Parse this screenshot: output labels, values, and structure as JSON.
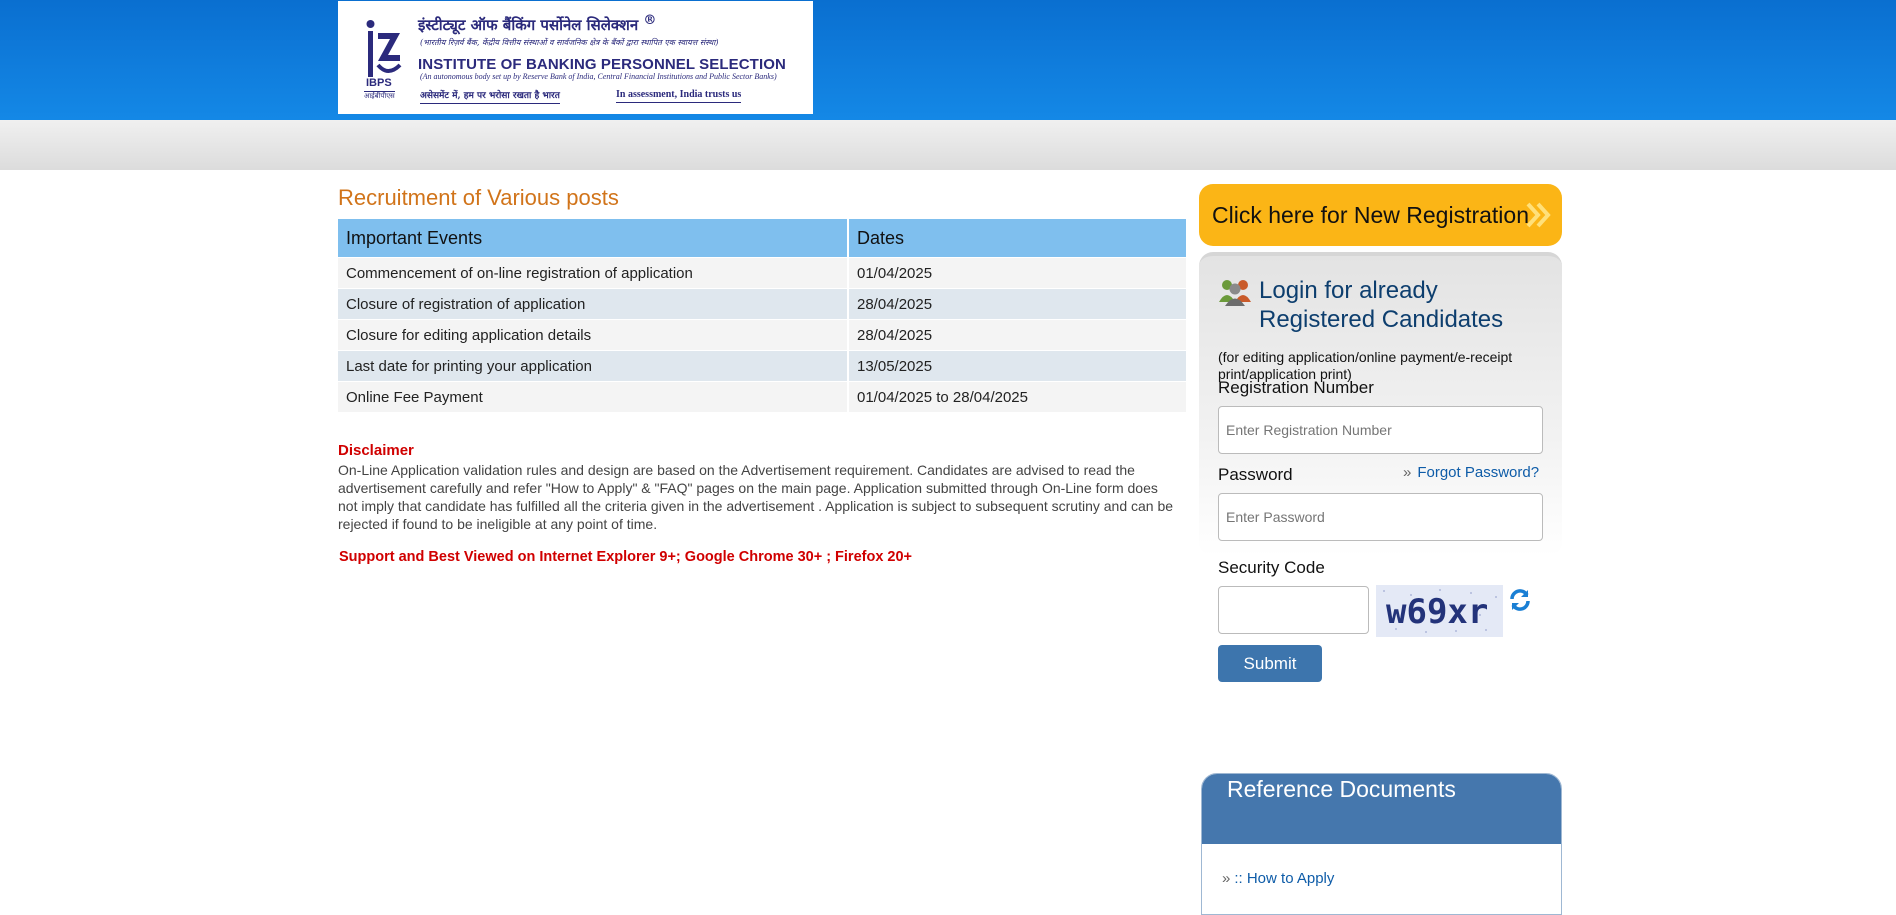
{
  "header": {
    "logo_hindi_title": "इंस्टीट्यूट ऑफ बैंकिंग पर्सोनेल सिलेक्शन",
    "logo_registered": "®",
    "logo_hindi_sub": "(भारतीय रिज़र्व बैंक, केंद्रीय वित्तीय संस्थाओं व सार्वजनिक क्षेत्र के बैंकों द्वारा स्थापित एक स्वायत्त संस्था)",
    "logo_title": "INSTITUTE OF BANKING PERSONNEL SELECTION",
    "logo_sub": "(An autonomous body set up by Reserve Bank of India, Central Financial Institutions and Public Sector Banks)",
    "logo_tag_hindi": "असेसमेंट में, हम पर भरोसा रखता है भारत",
    "logo_tag_english": "In assessment, India trusts us",
    "logo_ibps": "IBPS",
    "logo_ibps_hindi": "आईबीपीएस"
  },
  "main": {
    "title": "Recruitment of Various posts",
    "table": {
      "headers": [
        "Important Events",
        "Dates"
      ],
      "rows": [
        [
          "Commencement of on-line registration of application",
          "01/04/2025"
        ],
        [
          "Closure of registration of application",
          "28/04/2025"
        ],
        [
          "Closure for editing application details",
          "28/04/2025"
        ],
        [
          "Last date for printing your application",
          "13/05/2025"
        ],
        [
          "Online Fee Payment",
          "01/04/2025 to 28/04/2025"
        ]
      ]
    },
    "disclaimer_heading": "Disclaimer",
    "disclaimer_text": "On-Line Application validation rules and design are based on the Advertisement requirement. Candidates are advised to read the advertisement carefully and refer \"How to Apply\" & \"FAQ\" pages on the main page. Application submitted through On-Line form does not imply that candidate has fulfilled all the criteria given in the advertisement . Application is subject to subsequent scrutiny and can be rejected if found to be ineligible at any point of time.",
    "support_text": "Support and Best Viewed on Internet Explorer 9+; Google Chrome 30+ ; Firefox 20+"
  },
  "sidebar": {
    "new_registration_label": "Click here for New Registration",
    "login_title_line1": "Login for already",
    "login_title_line2": "Registered Candidates",
    "login_subtitle": "(for editing application/online payment/e-receipt print/application print)",
    "registration_label": "Registration Number",
    "registration_placeholder": "Enter Registration Number",
    "password_label": "Password",
    "password_placeholder": "Enter Password",
    "forgot_password": "Forgot Password?",
    "security_code_label": "Security Code",
    "security_code_value": "",
    "captcha_text": "w69xr",
    "submit_label": "Submit",
    "reference_title": "Reference Documents",
    "reference_links": [
      ":: How to Apply"
    ]
  },
  "colors": {
    "header_blue": "#0a6fd0",
    "accent_orange": "#d1741a",
    "registration_yellow": "#fbb516",
    "table_header": "#7fbfee",
    "disclaimer_red": "#d00000",
    "submit_blue": "#3d75ad",
    "link_blue": "#0e5ca8"
  },
  "icons": {
    "double_chevron": "double-chevron-right-icon",
    "users": "users-icon",
    "refresh": "refresh-icon"
  }
}
